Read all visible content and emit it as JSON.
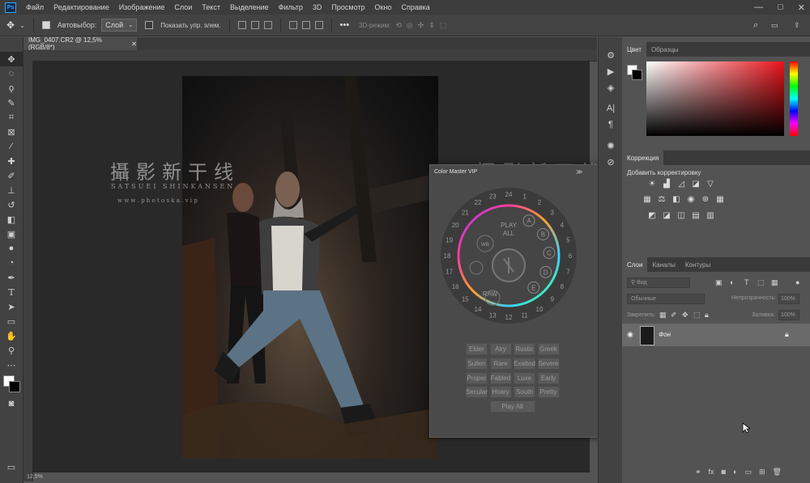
{
  "menubar": {
    "logo": "Ps",
    "items": [
      "Файл",
      "Редактирование",
      "Изображение",
      "Слои",
      "Текст",
      "Выделение",
      "Фильтр",
      "3D",
      "Просмотр",
      "Окно",
      "Справка"
    ],
    "window_controls": [
      "—",
      "□",
      "✕"
    ]
  },
  "options": {
    "autoselect_label": "Автовыбор:",
    "autoselect_value": "Слой",
    "show_transform_label": "Показать упр. элем.",
    "mode_3d_label": "3D-режим:",
    "more": "•••"
  },
  "document": {
    "tab_title": "IMG_0407.CR2 @ 12,5% (RGB/8*)",
    "watermark_cn": "攝影新干线",
    "watermark_en": "SATSUEI SHINKANSEN",
    "watermark_url": "w w w . p h o t o s k a . v i p",
    "status": "12,5%"
  },
  "color_master": {
    "title": "Color Master VIP",
    "play_label": "PLAY",
    "all_label": "ALL",
    "raw_label": "RAW",
    "wb_label": "WB",
    "numbers": [
      "24",
      "1",
      "2",
      "3",
      "4",
      "5",
      "6",
      "7",
      "8",
      "9",
      "10",
      "11",
      "12",
      "13",
      "14",
      "15",
      "16",
      "17",
      "18",
      "19",
      "20",
      "21",
      "22",
      "23"
    ],
    "letters": [
      "A",
      "B",
      "C",
      "D",
      "E"
    ],
    "presets": [
      [
        "Elder",
        "Airy",
        "Rustic",
        "Greek"
      ],
      [
        "Sullen",
        "Rare",
        "Exalted",
        "Severe"
      ],
      [
        "Proper",
        "Fabled",
        "Luxe",
        "Early"
      ],
      [
        "Secular",
        "Hoary",
        "South",
        "Pretty"
      ]
    ],
    "play_all": "Play All"
  },
  "panels": {
    "color_tab": "Цвет",
    "swatches_tab": "Образцы",
    "adjustments_tab": "Коррекция",
    "adjustments_hint": "Добавить корректировку",
    "layers_tab": "Слои",
    "channels_tab": "Каналы",
    "paths_tab": "Контуры",
    "filter_placeholder": "Вид",
    "blend_mode": "Обычные",
    "opacity_label": "Непрозрачность:",
    "opacity_value": "100%",
    "lock_label": "Закрепить:",
    "fill_label": "Заливка:",
    "fill_value": "100%",
    "layer_name": "Фон"
  },
  "colors": {
    "accent": "#31a8ff",
    "bg": "#535353"
  }
}
